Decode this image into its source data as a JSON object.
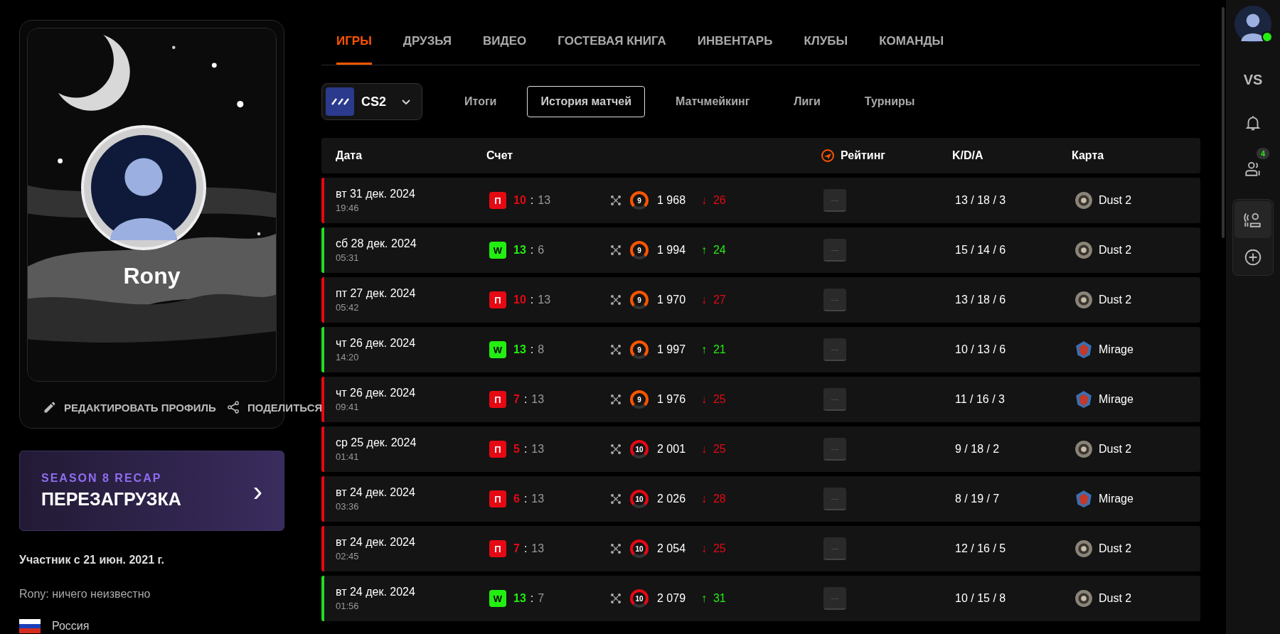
{
  "profile": {
    "name": "Rony",
    "actions": [
      {
        "kind": "edit",
        "label": "РЕДАКТИРОВАТЬ ПРОФИЛЬ"
      },
      {
        "kind": "share",
        "label": "ПОДЕЛИТЬСЯ"
      }
    ]
  },
  "recap": {
    "kicker": "SEASON 8 RECAP",
    "title": "ПЕРЕЗАГРУЗКА",
    "chevron": "›"
  },
  "member_since": "Участник с 21 июн. 2021 г.",
  "bio": "Rony: ничего неизвестно",
  "country": "Россия",
  "tabs": [
    {
      "label": "ИГРЫ",
      "selected": true
    },
    {
      "label": "ДРУЗЬЯ",
      "selected": false
    },
    {
      "label": "ВИДЕО",
      "selected": false
    },
    {
      "label": "ГОСТЕВАЯ КНИГА",
      "selected": false
    },
    {
      "label": "ИНВЕНТАРЬ",
      "selected": false
    },
    {
      "label": "КЛУБЫ",
      "selected": false
    },
    {
      "label": "КОМАНДЫ",
      "selected": false
    }
  ],
  "game_select": {
    "value": "CS2"
  },
  "subtabs": [
    {
      "label": "Итоги",
      "selected": false
    },
    {
      "label": "История матчей",
      "selected": true
    },
    {
      "label": "Матчмейкинг",
      "selected": false
    },
    {
      "label": "Лиги",
      "selected": false
    },
    {
      "label": "Турниры",
      "selected": false
    }
  ],
  "table": {
    "columns": [
      "Дата",
      "Счет",
      "Рейтинг",
      "K/D/A",
      "Карта"
    ],
    "rows": [
      {
        "kind": "loss",
        "date": "вт 31 дек. 2024",
        "time": "19:46",
        "badge": "П",
        "own": "10",
        "sep": ":",
        "opp": "13",
        "level": "9",
        "elo": "1 968",
        "arrow": "↓",
        "delta": "26",
        "rating": "---",
        "kda": "13 / 18 / 3",
        "map": {
          "kind": "dust",
          "name": "Dust 2"
        }
      },
      {
        "kind": "win",
        "date": "сб 28 дек. 2024",
        "time": "05:31",
        "badge": "W",
        "own": "13",
        "sep": ":",
        "opp": "6",
        "level": "9",
        "elo": "1 994",
        "arrow": "↑",
        "delta": "24",
        "rating": "---",
        "kda": "15 / 14 / 6",
        "map": {
          "kind": "dust",
          "name": "Dust 2"
        }
      },
      {
        "kind": "loss",
        "date": "пт 27 дек. 2024",
        "time": "05:42",
        "badge": "П",
        "own": "10",
        "sep": ":",
        "opp": "13",
        "level": "9",
        "elo": "1 970",
        "arrow": "↓",
        "delta": "27",
        "rating": "---",
        "kda": "13 / 18 / 6",
        "map": {
          "kind": "dust",
          "name": "Dust 2"
        }
      },
      {
        "kind": "win",
        "date": "чт 26 дек. 2024",
        "time": "14:20",
        "badge": "W",
        "own": "13",
        "sep": ":",
        "opp": "8",
        "level": "9",
        "elo": "1 997",
        "arrow": "↑",
        "delta": "21",
        "rating": "---",
        "kda": "10 / 13 / 6",
        "map": {
          "kind": "mirage",
          "name": "Mirage"
        }
      },
      {
        "kind": "loss",
        "date": "чт 26 дек. 2024",
        "time": "09:41",
        "badge": "П",
        "own": "7",
        "sep": ":",
        "opp": "13",
        "level": "9",
        "elo": "1 976",
        "arrow": "↓",
        "delta": "25",
        "rating": "---",
        "kda": "11 / 16 / 3",
        "map": {
          "kind": "mirage",
          "name": "Mirage"
        }
      },
      {
        "kind": "loss",
        "date": "ср 25 дек. 2024",
        "time": "01:41",
        "badge": "П",
        "own": "5",
        "sep": ":",
        "opp": "13",
        "level": "10",
        "elo": "2 001",
        "arrow": "↓",
        "delta": "25",
        "rating": "---",
        "kda": "9 / 18 / 2",
        "map": {
          "kind": "dust",
          "name": "Dust 2"
        }
      },
      {
        "kind": "loss",
        "date": "вт 24 дек. 2024",
        "time": "03:36",
        "badge": "П",
        "own": "6",
        "sep": ":",
        "opp": "13",
        "level": "10",
        "elo": "2 026",
        "arrow": "↓",
        "delta": "28",
        "rating": "---",
        "kda": "8 / 19 / 7",
        "map": {
          "kind": "mirage",
          "name": "Mirage"
        }
      },
      {
        "kind": "loss",
        "date": "вт 24 дек. 2024",
        "time": "02:45",
        "badge": "П",
        "own": "7",
        "sep": ":",
        "opp": "13",
        "level": "10",
        "elo": "2 054",
        "arrow": "↓",
        "delta": "25",
        "rating": "---",
        "kda": "12 / 16 / 5",
        "map": {
          "kind": "dust",
          "name": "Dust 2"
        }
      },
      {
        "kind": "win",
        "date": "вт 24 дек. 2024",
        "time": "01:56",
        "badge": "W",
        "own": "13",
        "sep": ":",
        "opp": "7",
        "level": "10",
        "elo": "2 079",
        "arrow": "↑",
        "delta": "31",
        "rating": "---",
        "kda": "10 / 15 / 8",
        "map": {
          "kind": "dust",
          "name": "Dust 2"
        }
      }
    ]
  },
  "rail": {
    "vs": "VS",
    "friends_count": "4",
    "online": true
  }
}
